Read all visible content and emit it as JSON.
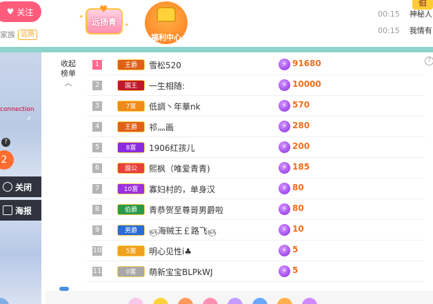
{
  "header": {
    "follow_label": "关注",
    "family_label": "家族",
    "family_tag": "远扬",
    "badge_label": "远扬青",
    "welfare_label": "福利中心",
    "corner_label": "伯",
    "chat": [
      {
        "time": "00:15",
        "message": "神秘人"
      },
      {
        "time": "00:15",
        "message": "我情有"
      }
    ]
  },
  "video": {
    "overlay_text": "connection",
    "help_mark": "?",
    "close_label": "关闭",
    "poster_label": "海报"
  },
  "ranking": {
    "collapse_label_1": "收起",
    "collapse_label_2": "榜单",
    "help_mark": "?",
    "rows": [
      {
        "rank": "1",
        "tag": "王爵",
        "tag_color": "#e0601a",
        "name": "雪松520",
        "score": "91680"
      },
      {
        "rank": "2",
        "tag": "国王",
        "tag_color": "#c0182a",
        "name": "一生相随:",
        "score": "10000"
      },
      {
        "rank": "3",
        "tag": "7富",
        "tag_color": "#f08a1a",
        "name": "低調丶年華nk",
        "score": "570"
      },
      {
        "rank": "4",
        "tag": "王爵",
        "tag_color": "#e0601a",
        "name": "祁灬画",
        "score": "280"
      },
      {
        "rank": "5",
        "tag": "8富",
        "tag_color": "#8a2be2",
        "name": "1906红孩儿",
        "score": "200"
      },
      {
        "rank": "6",
        "tag": "国公",
        "tag_color": "#e8403a",
        "name": "熙枫（唯爱青青)",
        "score": "185"
      },
      {
        "rank": "7",
        "tag": "10富",
        "tag_color": "#9b30e0",
        "name": "寡妇村的，单身汉",
        "score": "80"
      },
      {
        "rank": "8",
        "tag": "伯爵",
        "tag_color": "#2a9a4a",
        "name": "青恭贺至尊哥男爵啦",
        "score": "80"
      },
      {
        "rank": "9",
        "tag": "男爵",
        "tag_color": "#2a6ad8",
        "name": "ஞ海贼王￡路飞ஞ",
        "score": "10"
      },
      {
        "rank": "10",
        "tag": "5富",
        "tag_color": "#f0a020",
        "name": "明心见性i♣",
        "score": "5"
      },
      {
        "rank": "11",
        "tag": "0富",
        "tag_color": "#a8a8a8",
        "name": "萌新宝宝BLPkWJ",
        "score": "5"
      }
    ]
  },
  "colors": {
    "accent_pink": "#ff5c7c",
    "score_orange": "#f36c1c",
    "teal_band": "#8fd3cd"
  }
}
